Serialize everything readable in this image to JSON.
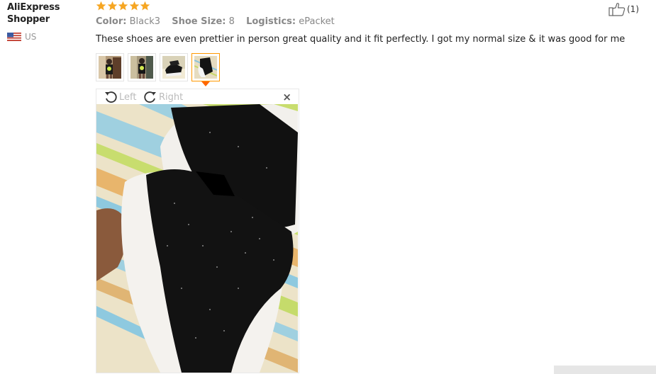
{
  "reviewer": {
    "name": "AliExpress Shopper",
    "country": "US",
    "flag_icon": "us-flag-icon"
  },
  "rating": {
    "stars": 5,
    "max": 5,
    "star_color": "#f6a623"
  },
  "attributes": [
    {
      "key": "Color:",
      "value": "Black3"
    },
    {
      "key": "Shoe Size:",
      "value": "8"
    },
    {
      "key": "Logistics:",
      "value": "ePacket"
    }
  ],
  "review_text": "These shoes are even prettier in person great quality and it fit perfectly. I got my normal size & it was good for me",
  "thumbnails": [
    {
      "icon": "photo-thumbnail",
      "active": false
    },
    {
      "icon": "photo-thumbnail",
      "active": false
    },
    {
      "icon": "photo-thumbnail",
      "active": false
    },
    {
      "icon": "photo-thumbnail",
      "active": true
    }
  ],
  "helpful": {
    "icon": "thumbs-up-icon",
    "count_label": "(1)"
  },
  "viewer": {
    "rotate_left_label": "Left",
    "rotate_right_label": "Right",
    "close_symbol": "×",
    "accent_color": "#ff6600"
  }
}
